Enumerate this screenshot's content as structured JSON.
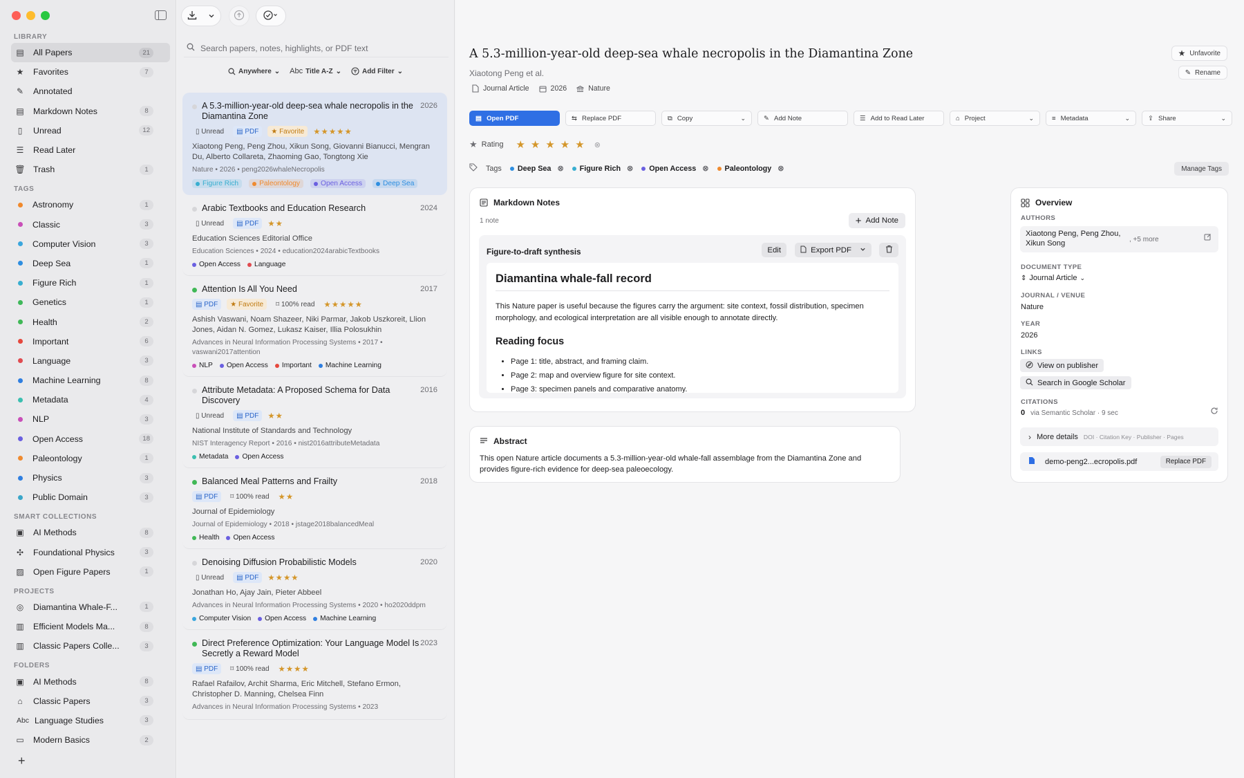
{
  "sidebar": {
    "library_header": "LIBRARY",
    "library": [
      {
        "label": "All Papers",
        "count": "21",
        "icon": "library-icon"
      },
      {
        "label": "Favorites",
        "count": "7",
        "icon": "star-icon"
      },
      {
        "label": "Annotated",
        "count": "",
        "icon": "pen-icon"
      },
      {
        "label": "Markdown Notes",
        "count": "8",
        "icon": "note-icon"
      },
      {
        "label": "Unread",
        "count": "12",
        "icon": "book-icon"
      },
      {
        "label": "Read Later",
        "count": "",
        "icon": "list-icon"
      },
      {
        "label": "Trash",
        "count": "1",
        "icon": "trash-icon"
      }
    ],
    "tags_header": "TAGS",
    "tags": [
      {
        "label": "Astronomy",
        "count": "1",
        "color": "#f0892b"
      },
      {
        "label": "Classic",
        "count": "3",
        "color": "#c94fb8"
      },
      {
        "label": "Computer Vision",
        "count": "3",
        "color": "#3aa6dd"
      },
      {
        "label": "Deep Sea",
        "count": "1",
        "color": "#2e8ee0"
      },
      {
        "label": "Figure Rich",
        "count": "1",
        "color": "#38aed0"
      },
      {
        "label": "Genetics",
        "count": "1",
        "color": "#3fb85a"
      },
      {
        "label": "Health",
        "count": "2",
        "color": "#40b856"
      },
      {
        "label": "Important",
        "count": "6",
        "color": "#e5483d"
      },
      {
        "label": "Language",
        "count": "3",
        "color": "#e04b50"
      },
      {
        "label": "Machine Learning",
        "count": "8",
        "color": "#2f7fe0"
      },
      {
        "label": "Metadata",
        "count": "4",
        "color": "#3bbfb0"
      },
      {
        "label": "NLP",
        "count": "3",
        "color": "#c94fb8"
      },
      {
        "label": "Open Access",
        "count": "18",
        "color": "#6a5fe0"
      },
      {
        "label": "Paleontology",
        "count": "1",
        "color": "#ef8a2f"
      },
      {
        "label": "Physics",
        "count": "3",
        "color": "#2f7fe0"
      },
      {
        "label": "Public Domain",
        "count": "3",
        "color": "#3aa6c9"
      }
    ],
    "smart_header": "SMART COLLECTIONS",
    "smart": [
      {
        "label": "AI Methods",
        "count": "8",
        "icon": "cpu-icon"
      },
      {
        "label": "Foundational Physics",
        "count": "3",
        "icon": "atom-icon"
      },
      {
        "label": "Open Figure Papers",
        "count": "1",
        "icon": "image-icon"
      }
    ],
    "projects_header": "PROJECTS",
    "projects": [
      {
        "label": "Diamantina Whale-F...",
        "count": "1",
        "icon": "target-icon"
      },
      {
        "label": "Efficient Models Ma...",
        "count": "8",
        "icon": "doc-icon"
      },
      {
        "label": "Classic Papers Colle...",
        "count": "3",
        "icon": "doc-icon"
      }
    ],
    "folders_header": "FOLDERS",
    "folders": [
      {
        "label": "AI Methods",
        "count": "8",
        "icon": "cpu-icon"
      },
      {
        "label": "Classic Papers",
        "count": "3",
        "icon": "bank-icon"
      },
      {
        "label": "Language Studies",
        "count": "3",
        "icon": "abc-icon"
      },
      {
        "label": "Modern Basics",
        "count": "2",
        "icon": "folder-icon"
      }
    ],
    "add_label": "+"
  },
  "list": {
    "search_placeholder": "Search papers, notes, highlights, or PDF text",
    "filter_scope": "Anywhere",
    "filter_sort": "Title A-Z",
    "filter_add": "Add Filter",
    "abc_label": "Abc",
    "papers": [
      {
        "title": "A 5.3-million-year-old deep-sea whale necropolis in the Diamantina Zone",
        "year": "2026",
        "status_color": "",
        "badges": [
          "Unread",
          "PDF",
          "Favorite"
        ],
        "stars": "★★★★★",
        "authors": "Xiaotong Peng, Peng Zhou, Xikun Song, Giovanni Bianucci, Mengran Du, Alberto Collareta, Zhaoming Gao, Tongtong Xie",
        "venue": "Nature • 2026 • peng2026whaleNecropolis",
        "tags": [
          {
            "label": "Figure Rich",
            "color": "#38aed0"
          },
          {
            "label": "Paleontology",
            "color": "#ef8a2f"
          },
          {
            "label": "Open Access",
            "color": "#6a5fe0"
          },
          {
            "label": "Deep Sea",
            "color": "#2e8ee0"
          }
        ]
      },
      {
        "title": "Arabic Textbooks and Education Research",
        "year": "2024",
        "status_color": "",
        "badges": [
          "Unread",
          "PDF"
        ],
        "stars": "★★",
        "authors": "Education Sciences Editorial Office",
        "venue": "Education Sciences • 2024 • education2024arabicTextbooks",
        "tags": [
          {
            "label": "Open Access",
            "color": "#6a5fe0"
          },
          {
            "label": "Language",
            "color": "#e04b50"
          }
        ]
      },
      {
        "title": "Attention Is All You Need",
        "year": "2017",
        "status_color": "#40b856",
        "badges": [
          "PDF",
          "Favorite",
          "100% read"
        ],
        "stars": "★★★★★",
        "authors": "Ashish Vaswani, Noam Shazeer, Niki Parmar, Jakob Uszkoreit, Llion Jones, Aidan N. Gomez, Lukasz Kaiser, Illia Polosukhin",
        "venue": "Advances in Neural Information Processing Systems • 2017 • vaswani2017attention",
        "tags": [
          {
            "label": "NLP",
            "color": "#c94fb8"
          },
          {
            "label": "Open Access",
            "color": "#6a5fe0"
          },
          {
            "label": "Important",
            "color": "#e5483d"
          },
          {
            "label": "Machine Learning",
            "color": "#2f7fe0"
          }
        ]
      },
      {
        "title": "Attribute Metadata: A Proposed Schema for Data Discovery",
        "year": "2016",
        "status_color": "",
        "badges": [
          "Unread",
          "PDF"
        ],
        "stars": "★★",
        "authors": "National Institute of Standards and Technology",
        "venue": "NIST Interagency Report • 2016 • nist2016attributeMetadata",
        "tags": [
          {
            "label": "Metadata",
            "color": "#3bbfb0"
          },
          {
            "label": "Open Access",
            "color": "#6a5fe0"
          }
        ]
      },
      {
        "title": "Balanced Meal Patterns and Frailty",
        "year": "2018",
        "status_color": "#40b856",
        "badges": [
          "PDF",
          "100% read"
        ],
        "stars": "★★",
        "authors": "Journal of Epidemiology",
        "venue": "Journal of Epidemiology • 2018 • jstage2018balancedMeal",
        "tags": [
          {
            "label": "Health",
            "color": "#40b856"
          },
          {
            "label": "Open Access",
            "color": "#6a5fe0"
          }
        ]
      },
      {
        "title": "Denoising Diffusion Probabilistic Models",
        "year": "2020",
        "status_color": "",
        "badges": [
          "Unread",
          "PDF"
        ],
        "stars": "★★★★",
        "authors": "Jonathan Ho, Ajay Jain, Pieter Abbeel",
        "venue": "Advances in Neural Information Processing Systems • 2020 • ho2020ddpm",
        "tags": [
          {
            "label": "Computer Vision",
            "color": "#3aa6dd"
          },
          {
            "label": "Open Access",
            "color": "#6a5fe0"
          },
          {
            "label": "Machine Learning",
            "color": "#2f7fe0"
          }
        ]
      },
      {
        "title": "Direct Preference Optimization: Your Language Model Is Secretly a Reward Model",
        "year": "2023",
        "status_color": "#40b856",
        "badges": [
          "PDF",
          "100% read"
        ],
        "stars": "★★★★",
        "authors": "Rafael Rafailov, Archit Sharma, Eric Mitchell, Stefano Ermon, Christopher D. Manning, Chelsea Finn",
        "venue": "Advances in Neural Information Processing Systems • 2023",
        "tags": []
      }
    ]
  },
  "detail": {
    "title": "A 5.3-million-year-old deep-sea whale necropolis in the Diamantina Zone",
    "authors": "Xiaotong Peng et al.",
    "unfavorite_label": "Unfavorite",
    "rename_label": "Rename",
    "doc_type": "Journal Article",
    "year": "2026",
    "venue": "Nature",
    "actions": [
      "Open PDF",
      "Replace PDF",
      "Copy",
      "Add Note",
      "Add to Read Later",
      "Project",
      "Metadata",
      "Share"
    ],
    "rating_label": "Rating",
    "rating_stars": "★★★★★",
    "rating_value": 5,
    "tags_label": "Tags",
    "tags": [
      {
        "label": "Deep Sea",
        "color": "#2e8ee0"
      },
      {
        "label": "Figure Rich",
        "color": "#38aed0"
      },
      {
        "label": "Open Access",
        "color": "#6a5fe0"
      },
      {
        "label": "Paleontology",
        "color": "#ef8a2f"
      }
    ],
    "manage_tags_label": "Manage Tags",
    "notes": {
      "header": "Markdown Notes",
      "count": "1 note",
      "add_label": "Add Note",
      "note_title": "Figure-to-draft synthesis",
      "edit_label": "Edit",
      "export_label": "Export PDF",
      "h1": "Diamantina whale-fall record",
      "p": "This Nature paper is useful because the figures carry the argument: site context, fossil distribution, specimen morphology, and ecological interpretation are all visible enough to annotate directly.",
      "h2": "Reading focus",
      "list": [
        "Page 1: title, abstract, and framing claim.",
        "Page 2: map and overview figure for site context.",
        "Page 3: specimen panels and comparative anatomy."
      ]
    },
    "abstract": {
      "header": "Abstract",
      "text": "This open Nature article documents a 5.3-million-year-old whale-fall assemblage from the Diamantina Zone and provides figure-rich evidence for deep-sea paleoecology."
    },
    "overview": {
      "header": "Overview",
      "authors_label": "AUTHORS",
      "authors_line1": "Xiaotong Peng, Peng Zhou,",
      "authors_line2": "Xikun Song",
      "authors_more": ", +5 more",
      "doctype_label": "DOCUMENT TYPE",
      "doctype_value": "Journal Article",
      "venue_label": "JOURNAL / VENUE",
      "venue_value": "Nature",
      "year_label": "YEAR",
      "year_value": "2026",
      "links_label": "LINKS",
      "link_publisher": "View on publisher",
      "link_scholar": "Search in Google Scholar",
      "citations_label": "CITATIONS",
      "citations_value": "0",
      "citations_source": "via Semantic Scholar · 9 sec",
      "more_details": "More details",
      "more_details_sub": "DOI · Citation Key · Publisher · Pages",
      "file_name": "demo-peng2...ecropolis.pdf",
      "replace_label": "Replace PDF"
    }
  }
}
